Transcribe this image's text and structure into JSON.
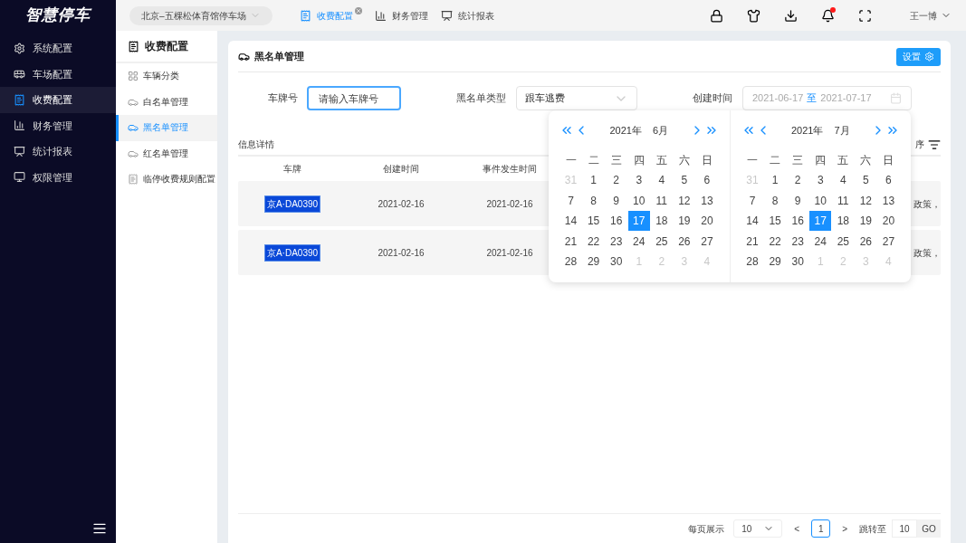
{
  "logo": "智慧停车",
  "sidebar": {
    "items": [
      {
        "label": "系统配置",
        "selected": false
      },
      {
        "label": "车场配置",
        "selected": false
      },
      {
        "label": "收费配置",
        "selected": true
      },
      {
        "label": "财务管理",
        "selected": false
      },
      {
        "label": "统计报表",
        "selected": false
      },
      {
        "label": "权限管理",
        "selected": false
      }
    ]
  },
  "topbar": {
    "parking_lot": "北京–五棵松体育馆停车场",
    "tabs": [
      {
        "label": "收费配置",
        "selected": true,
        "closable": true
      },
      {
        "label": "财务管理",
        "selected": false,
        "closable": false
      },
      {
        "label": "统计报表",
        "selected": false,
        "closable": false
      }
    ],
    "notification_dot": true,
    "user": "王一博"
  },
  "submenu": {
    "title": "收费配置",
    "items": [
      {
        "label": "车辆分类",
        "selected": false
      },
      {
        "label": "白名单管理",
        "selected": false
      },
      {
        "label": "黑名单管理",
        "selected": true
      },
      {
        "label": "红名单管理",
        "selected": false
      },
      {
        "label": "临停收费规则配置",
        "selected": false
      }
    ]
  },
  "panel": {
    "title": "黑名单管理",
    "settings_button": "设置",
    "filters": {
      "plate_label": "车牌号",
      "plate_placeholder": "请输入车牌号",
      "type_label": "黑名单类型",
      "type_value": "跟车逃费",
      "date_label": "创建时间",
      "date_start": "2021-06-17",
      "date_separator": "至",
      "date_end": "2021-07-17"
    },
    "section_title": "信息详情",
    "sort_label": "序",
    "table": {
      "columns": [
        "车牌",
        "创建时间",
        "事件发生时间"
      ],
      "rows": [
        {
          "plate": "京A·DA0390",
          "created": "2021-02-16",
          "occurred": "2021-02-16",
          "column_4": "政策，"
        },
        {
          "plate": "京A·DA0390",
          "created": "2021-02-16",
          "occurred": "2021-02-16",
          "column_4": "政策，"
        }
      ]
    },
    "pagination": {
      "page_size_label": "每页展示",
      "page_size": "10",
      "prev": "<",
      "pages": [
        {
          "label": "1",
          "selected": true
        }
      ],
      "next": ">",
      "jump_label": "跳转至",
      "jump_value": "10",
      "go": "GO"
    }
  },
  "calendar": {
    "months": [
      {
        "year": "2021年",
        "month": "6月",
        "weekdays": [
          "一",
          "二",
          "三",
          "四",
          "五",
          "六",
          "日"
        ],
        "days": [
          {
            "t": "31",
            "outside": true,
            "selected": false
          },
          {
            "t": "1",
            "outside": false,
            "selected": false
          },
          {
            "t": "2",
            "outside": false,
            "selected": false
          },
          {
            "t": "3",
            "outside": false,
            "selected": false
          },
          {
            "t": "4",
            "outside": false,
            "selected": false
          },
          {
            "t": "5",
            "outside": false,
            "selected": false
          },
          {
            "t": "6",
            "outside": false,
            "selected": false
          },
          {
            "t": "7",
            "outside": false,
            "selected": false
          },
          {
            "t": "8",
            "outside": false,
            "selected": false
          },
          {
            "t": "9",
            "outside": false,
            "selected": false
          },
          {
            "t": "10",
            "outside": false,
            "selected": false
          },
          {
            "t": "11",
            "outside": false,
            "selected": false
          },
          {
            "t": "12",
            "outside": false,
            "selected": false
          },
          {
            "t": "13",
            "outside": false,
            "selected": false
          },
          {
            "t": "14",
            "outside": false,
            "selected": false
          },
          {
            "t": "15",
            "outside": false,
            "selected": false
          },
          {
            "t": "16",
            "outside": false,
            "selected": false
          },
          {
            "t": "17",
            "outside": false,
            "selected": true
          },
          {
            "t": "18",
            "outside": false,
            "selected": false
          },
          {
            "t": "19",
            "outside": false,
            "selected": false
          },
          {
            "t": "20",
            "outside": false,
            "selected": false
          },
          {
            "t": "21",
            "outside": false,
            "selected": false
          },
          {
            "t": "22",
            "outside": false,
            "selected": false
          },
          {
            "t": "23",
            "outside": false,
            "selected": false
          },
          {
            "t": "24",
            "outside": false,
            "selected": false
          },
          {
            "t": "25",
            "outside": false,
            "selected": false
          },
          {
            "t": "26",
            "outside": false,
            "selected": false
          },
          {
            "t": "27",
            "outside": false,
            "selected": false
          },
          {
            "t": "28",
            "outside": false,
            "selected": false
          },
          {
            "t": "29",
            "outside": false,
            "selected": false
          },
          {
            "t": "30",
            "outside": false,
            "selected": false
          },
          {
            "t": "1",
            "outside": true,
            "selected": false
          },
          {
            "t": "2",
            "outside": true,
            "selected": false
          },
          {
            "t": "3",
            "outside": true,
            "selected": false
          },
          {
            "t": "4",
            "outside": true,
            "selected": false
          }
        ]
      },
      {
        "year": "2021年",
        "month": "7月",
        "weekdays": [
          "一",
          "二",
          "三",
          "四",
          "五",
          "六",
          "日"
        ],
        "days": [
          {
            "t": "31",
            "outside": true,
            "selected": false
          },
          {
            "t": "1",
            "outside": false,
            "selected": false
          },
          {
            "t": "2",
            "outside": false,
            "selected": false
          },
          {
            "t": "3",
            "outside": false,
            "selected": false
          },
          {
            "t": "4",
            "outside": false,
            "selected": false
          },
          {
            "t": "5",
            "outside": false,
            "selected": false
          },
          {
            "t": "6",
            "outside": false,
            "selected": false
          },
          {
            "t": "7",
            "outside": false,
            "selected": false
          },
          {
            "t": "8",
            "outside": false,
            "selected": false
          },
          {
            "t": "9",
            "outside": false,
            "selected": false
          },
          {
            "t": "10",
            "outside": false,
            "selected": false
          },
          {
            "t": "11",
            "outside": false,
            "selected": false
          },
          {
            "t": "12",
            "outside": false,
            "selected": false
          },
          {
            "t": "13",
            "outside": false,
            "selected": false
          },
          {
            "t": "14",
            "outside": false,
            "selected": false
          },
          {
            "t": "15",
            "outside": false,
            "selected": false
          },
          {
            "t": "16",
            "outside": false,
            "selected": false
          },
          {
            "t": "17",
            "outside": false,
            "selected": true
          },
          {
            "t": "18",
            "outside": false,
            "selected": false
          },
          {
            "t": "19",
            "outside": false,
            "selected": false
          },
          {
            "t": "20",
            "outside": false,
            "selected": false
          },
          {
            "t": "21",
            "outside": false,
            "selected": false
          },
          {
            "t": "22",
            "outside": false,
            "selected": false
          },
          {
            "t": "23",
            "outside": false,
            "selected": false
          },
          {
            "t": "24",
            "outside": false,
            "selected": false
          },
          {
            "t": "25",
            "outside": false,
            "selected": false
          },
          {
            "t": "26",
            "outside": false,
            "selected": false
          },
          {
            "t": "27",
            "outside": false,
            "selected": false
          },
          {
            "t": "28",
            "outside": false,
            "selected": false
          },
          {
            "t": "29",
            "outside": false,
            "selected": false
          },
          {
            "t": "30",
            "outside": false,
            "selected": false
          },
          {
            "t": "1",
            "outside": true,
            "selected": false
          },
          {
            "t": "2",
            "outside": true,
            "selected": false
          },
          {
            "t": "3",
            "outside": true,
            "selected": false
          },
          {
            "t": "4",
            "outside": true,
            "selected": false
          }
        ]
      }
    ]
  }
}
